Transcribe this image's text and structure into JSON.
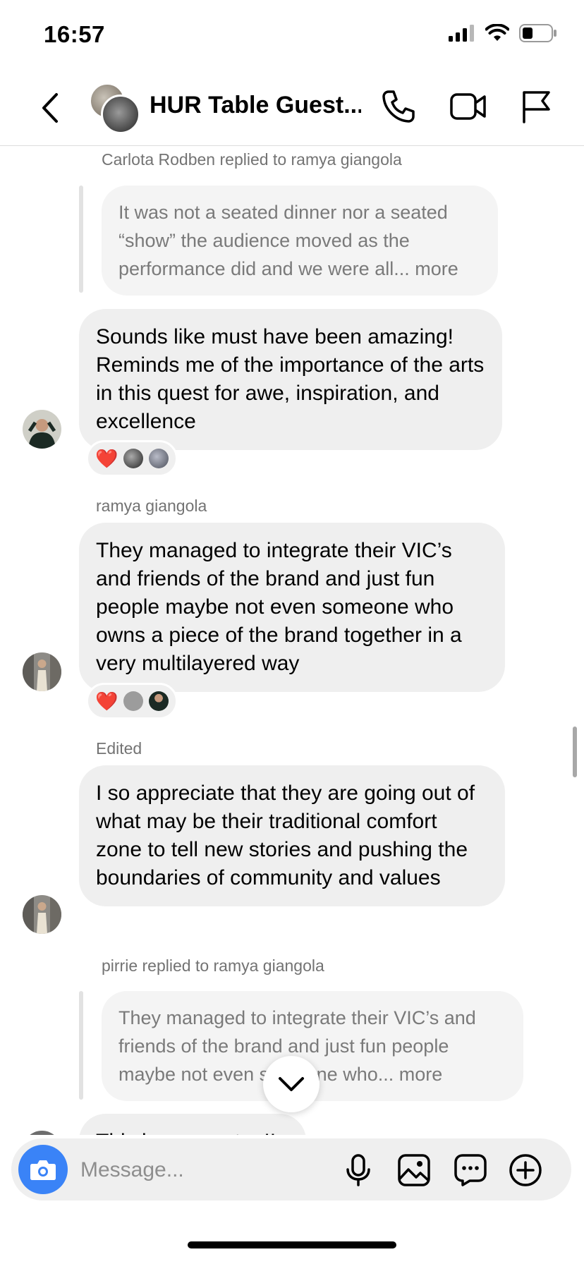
{
  "status_bar": {
    "time": "16:57"
  },
  "header": {
    "title": "HUR Table Guest..."
  },
  "messages": [
    {
      "meta": "Carlota Rodben replied to ramya giangola",
      "quoted": "It was not a seated dinner nor a seated “show” the audience moved as the performance did and we were all... more",
      "text": "Sounds like must have been amazing! Reminds me of the importance of the arts in this quest for awe, inspiration, and excellence",
      "reactions": {
        "emoji": "❤️"
      }
    },
    {
      "meta": "ramya giangola",
      "text": "They managed to integrate their VIC’s and friends of the brand and just fun people maybe not even someone who owns a piece of the brand together in a very multilayered way",
      "reactions": {
        "emoji": "❤️"
      }
    },
    {
      "meta": "Edited",
      "text": "I so appreciate that they are going out of what may be their traditional comfort zone to tell new stories and pushing the boundaries of community and values"
    },
    {
      "meta": "pirrie replied to ramya giangola",
      "quoted": "They managed to integrate their VIC’s and friends of the brand and just fun people maybe not even someone who... more",
      "text": "This is so rare too!!"
    }
  ],
  "composer": {
    "placeholder": "Message..."
  },
  "icons": {
    "back": "chevron-left-icon",
    "call": "phone-icon",
    "video": "video-camera-icon",
    "report": "flag-icon",
    "camera": "camera-icon",
    "mic": "microphone-icon",
    "gallery": "image-icon",
    "sticker": "chat-bubble-icon",
    "add": "plus-circle-icon",
    "scroll_down": "chevron-down-icon"
  },
  "colors": {
    "accent": "#3a83f7",
    "bubble": "#efefef",
    "heart": "#e3262f"
  }
}
